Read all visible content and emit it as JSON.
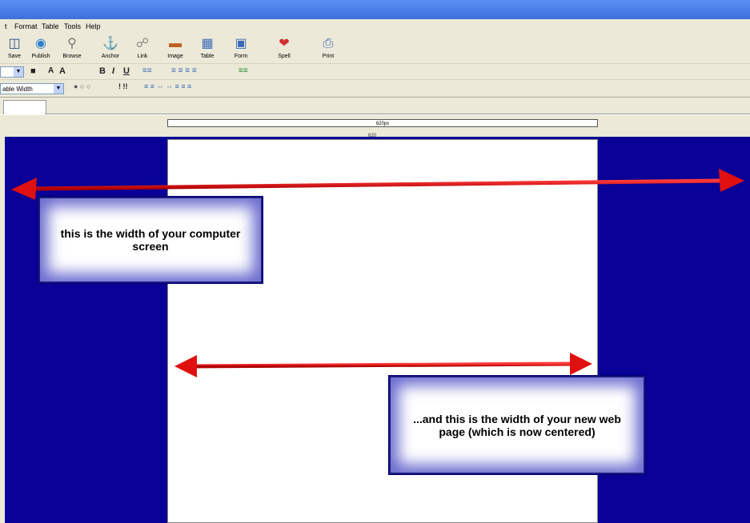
{
  "menu": {
    "items": [
      "t",
      "Format",
      "Table",
      "Tools",
      "Help"
    ]
  },
  "toolbar": {
    "buttons": [
      {
        "label": "Save",
        "icon": "save-icon"
      },
      {
        "label": "Publish",
        "icon": "globe-icon"
      },
      {
        "label": "Browse",
        "icon": "magnifier-icon"
      },
      {
        "label": "Anchor",
        "icon": "anchor-icon"
      },
      {
        "label": "Link",
        "icon": "link-icon"
      },
      {
        "label": "Image",
        "icon": "image-icon"
      },
      {
        "label": "Table",
        "icon": "table-icon"
      },
      {
        "label": "Form",
        "icon": "form-icon"
      },
      {
        "label": "Spell",
        "icon": "spell-icon"
      },
      {
        "label": "Print",
        "icon": "printer-icon"
      }
    ]
  },
  "format": {
    "table_width_select": "able Width"
  },
  "ruler": {
    "label": "620px"
  },
  "page": {
    "width_label": "620"
  },
  "annotations": {
    "screen_width": "this is the width of your computer screen",
    "page_width": "...and this is the width of your new web page (which is now centered)"
  },
  "colors": {
    "canvas_background": "#0a0296",
    "arrow": "#e01010"
  }
}
